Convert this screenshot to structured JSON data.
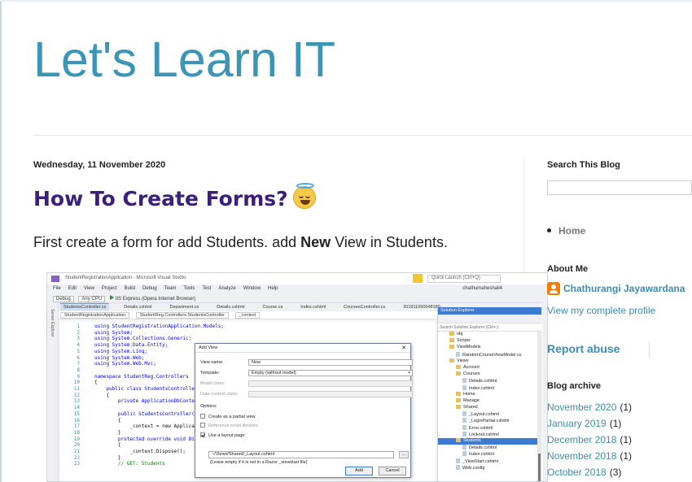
{
  "blog": {
    "title": "Let's Learn IT"
  },
  "post": {
    "date": "Wednesday, 11 November 2020",
    "title": "How To Create Forms?",
    "emoji": "smiling-face-with-halo",
    "body_start": "First create a form for add Students. add ",
    "body_bold": "New",
    "body_end": " View in Students."
  },
  "screenshot": {
    "window_title": "StudentRegistrationApplication - Microsoft Visual Studio",
    "quick_launch": "Quick Launch (Ctrl+Q)",
    "user": "chathumaheshali4",
    "menu": [
      "File",
      "Edit",
      "View",
      "Project",
      "Build",
      "Debug",
      "Team",
      "Tools",
      "Test",
      "Analyze",
      "Window",
      "Help"
    ],
    "toolbar": {
      "config": "Debug",
      "platform": "Any CPU",
      "run": "IIS Express (Opera Internet Browser)"
    },
    "tabs": [
      "StudentsController.cs",
      "Details.cshtml",
      "Department.cs",
      "Details.cshtml",
      "Course.cs",
      "Index.cshtml",
      "CoursesController.cs",
      "201811050648180_"
    ],
    "breadcrumb": [
      "StudentRegistrationApplication",
      "StudentReg.Controllers.StudentsController",
      "_context"
    ],
    "side_tab": "Server Explorer",
    "code_lines": [
      {
        "n": "1",
        "t": "using StudentRegistrationApplication.Models;"
      },
      {
        "n": "2",
        "t": "using System;"
      },
      {
        "n": "3",
        "t": "using System.Collections.Generic;"
      },
      {
        "n": "4",
        "t": "using System.Data.Entity;"
      },
      {
        "n": "5",
        "t": "using System.Linq;"
      },
      {
        "n": "6",
        "t": "using System.Web;"
      },
      {
        "n": "7",
        "t": "using System.Web.Mvc;"
      },
      {
        "n": "8",
        "t": ""
      },
      {
        "n": "9",
        "t": "namespace StudentReg.Controllers"
      },
      {
        "n": "10",
        "t": "{"
      },
      {
        "n": "11",
        "t": "    public class StudentsController : C"
      },
      {
        "n": "12",
        "t": "    {"
      },
      {
        "n": "13",
        "t": "        private ApplicationDbContext _"
      },
      {
        "n": "14",
        "t": ""
      },
      {
        "n": "15",
        "t": "        public StudentsController()"
      },
      {
        "n": "16",
        "t": "        {"
      },
      {
        "n": "17",
        "t": "            _context = new Application"
      },
      {
        "n": "18",
        "t": "        }"
      },
      {
        "n": "19",
        "t": "        protected override void Dispose"
      },
      {
        "n": "20",
        "t": "        {"
      },
      {
        "n": "21",
        "t": "            _context.Dispose();"
      },
      {
        "n": "22",
        "t": "        }"
      },
      {
        "n": "23",
        "t": "        // GET: Students"
      }
    ],
    "dialog": {
      "title": "Add View",
      "view_name_label": "View name:",
      "view_name": "New",
      "template_label": "Template:",
      "template": "Empty (without model)",
      "model_class_label": "Model class:",
      "data_context_label": "Data context class:",
      "options_label": "Options:",
      "partial_view": "Create as a partial view",
      "ref_scripts": "Reference script libraries",
      "use_layout": "Use a layout page:",
      "layout_path": "~/Views/Shared/_Layout.cshtml",
      "layout_hint": "(Leave empty if it is set in a Razor _viewstart file)",
      "browse": "...",
      "add": "Add",
      "cancel": "Cancel"
    },
    "solution_explorer": {
      "title": "Solution Explorer",
      "search": "Search Solution Explorer (Ctrl+;)",
      "items": [
        {
          "label": "obj",
          "indent": 1,
          "folder": true
        },
        {
          "label": "Scripts",
          "indent": 1,
          "folder": true
        },
        {
          "label": "ViewModels",
          "indent": 1,
          "folder": true
        },
        {
          "label": "RandomCourseViewModel.cs",
          "indent": 2,
          "folder": false
        },
        {
          "label": "Views",
          "indent": 1,
          "folder": true
        },
        {
          "label": "Account",
          "indent": 2,
          "folder": true
        },
        {
          "label": "Courses",
          "indent": 2,
          "folder": true
        },
        {
          "label": "Details.cshtml",
          "indent": 3,
          "folder": false
        },
        {
          "label": "Index.cshtml",
          "indent": 3,
          "folder": false
        },
        {
          "label": "Home",
          "indent": 2,
          "folder": true
        },
        {
          "label": "Manage",
          "indent": 2,
          "folder": true
        },
        {
          "label": "Shared",
          "indent": 2,
          "folder": true
        },
        {
          "label": "_Layout.cshtml",
          "indent": 3,
          "folder": false
        },
        {
          "label": "_LoginPartial.cshtml",
          "indent": 3,
          "folder": false
        },
        {
          "label": "Error.cshtml",
          "indent": 3,
          "folder": false
        },
        {
          "label": "Lockout.cshtml",
          "indent": 3,
          "folder": false
        },
        {
          "label": "Students",
          "indent": 2,
          "folder": true,
          "selected": true
        },
        {
          "label": "Details.cshtml",
          "indent": 3,
          "folder": false
        },
        {
          "label": "Index.cshtml",
          "indent": 3,
          "folder": false
        },
        {
          "label": "_ViewStart.cshtml",
          "indent": 2,
          "folder": false
        },
        {
          "label": "Web.config",
          "indent": 2,
          "folder": false
        }
      ]
    }
  },
  "sidebar": {
    "search_heading": "Search This Blog",
    "pages": [
      {
        "label": "Home"
      }
    ],
    "about_heading": "About Me",
    "profile_name": "Chathurangi Jayawardana",
    "profile_link": "View my complete profile",
    "report_abuse": "Report abuse",
    "archive_heading": "Blog archive",
    "archive": [
      {
        "label": "November 2020",
        "count": "(1)"
      },
      {
        "label": "January 2019",
        "count": "(1)"
      },
      {
        "label": "December 2018",
        "count": "(1)"
      },
      {
        "label": "November 2018",
        "count": "(1)"
      },
      {
        "label": "October 2018",
        "count": "(3)"
      }
    ]
  }
}
